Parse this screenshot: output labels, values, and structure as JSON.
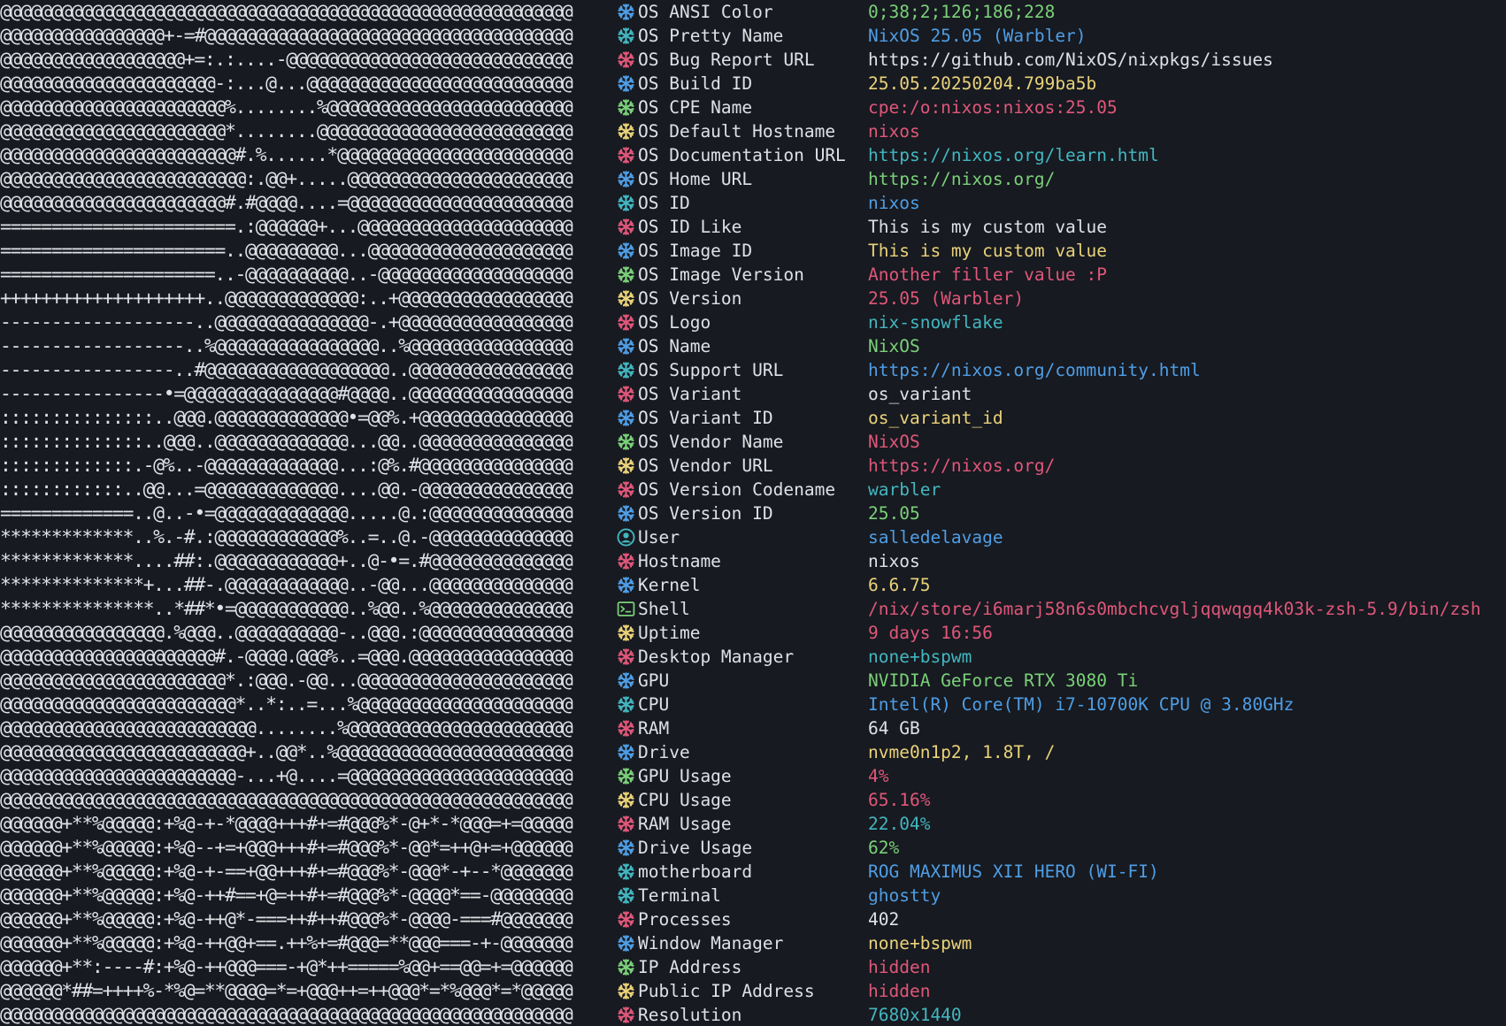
{
  "colors": {
    "background": "#171a20",
    "text": "#dfe1e5",
    "blue": "#4f9ee6",
    "cyan": "#43b6c0",
    "green": "#7bd07a",
    "yellow": "#ead27a",
    "red": "#e0577a"
  },
  "ascii_art": [
    "@@@@@@@@@@@@@@@@@@@@@@@@@@@@@@@@@@@@@@@@@@@@@@@@@@@@@@@@",
    "@@@@@@@@@@@@@@@@+-=#@@@@@@@@@@@@@@@@@@@@@@@@@@@@@@@@@@@@",
    "@@@@@@@@@@@@@@@@@@+=:.:....-@@@@@@@@@@@@@@@@@@@@@@@@@@@@",
    "@@@@@@@@@@@@@@@@@@@@@-:...@...@@@@@@@@@@@@@@@@@@@@@@@@@@",
    "@@@@@@@@@@@@@@@@@@@@@@%........%@@@@@@@@@@@@@@@@@@@@@@@@",
    "@@@@@@@@@@@@@@@@@@@@@@*........@@@@@@@@@@@@@@@@@@@@@@@@@",
    "@@@@@@@@@@@@@@@@@@@@@@@#.%......*@@@@@@@@@@@@@@@@@@@@@@@",
    "@@@@@@@@@@@@@@@@@@@@@@@@:.@@+.....@@@@@@@@@@@@@@@@@@@@@@",
    "@@@@@@@@@@@@@@@@@@@@@@#.#@@@@....=@@@@@@@@@@@@@@@@@@@@@@",
    "=======================.:@@@@@@+...@@@@@@@@@@@@@@@@@@@@@",
    "======================..@@@@@@@@@...@@@@@@@@@@@@@@@@@@@@",
    "=====================..-@@@@@@@@@@..-@@@@@@@@@@@@@@@@@@@",
    "++++++++++++++++++++..@@@@@@@@@@@@@:..+@@@@@@@@@@@@@@@@@",
    "-------------------..@@@@@@@@@@@@@@@-.+@@@@@@@@@@@@@@@@@",
    "------------------..%@@@@@@@@@@@@@@@@..%@@@@@@@@@@@@@@@@",
    "-----------------..#@@@@@@@@@@@@@@@@@@..@@@@@@@@@@@@@@@@",
    "----------------•=@@@@@@@@@@@@@@@#@@@@..@@@@@@@@@@@@@@@@",
    ":::::::::::::::..@@@.@@@@@@@@@@@@@•=@@%.+@@@@@@@@@@@@@@@",
    "::::::::::::::..@@@..@@@@@@@@@@@@@...@@..@@@@@@@@@@@@@@@",
    ":::::::::::::.-@%..-@@@@@@@@@@@@@...:@%.#@@@@@@@@@@@@@@@",
    "::::::::::::..@@...=@@@@@@@@@@@@@....@@.-@@@@@@@@@@@@@@@",
    "=============..@..-•=@@@@@@@@@@@@@.....@.:@@@@@@@@@@@@@@",
    "*************..%.-#.:@@@@@@@@@@@@%..=..@.-@@@@@@@@@@@@@@",
    "*************....##:.@@@@@@@@@@@@+..@-•=.#@@@@@@@@@@@@@@",
    "**************+...##-.@@@@@@@@@@@@..-@@...@@@@@@@@@@@@@@",
    "***************..*##*•=@@@@@@@@@@@..%@@..%@@@@@@@@@@@@@@",
    "@@@@@@@@@@@@@@@@.%@@@..@@@@@@@@@@-..@@@.:@@@@@@@@@@@@@@@",
    "@@@@@@@@@@@@@@@@@@@@@#.-@@@@.@@@%..=@@@.@@@@@@@@@@@@@@@@",
    "@@@@@@@@@@@@@@@@@@@@@@*.:@@@.-@@...@@@@@@@@@@@@@@@@@@@@@",
    "@@@@@@@@@@@@@@@@@@@@@@@*..*:..=...%@@@@@@@@@@@@@@@@@@@@@",
    "@@@@@@@@@@@@@@@@@@@@@@@@@........%@@@@@@@@@@@@@@@@@@@@@@",
    "@@@@@@@@@@@@@@@@@@@@@@@@+..@@*..%@@@@@@@@@@@@@@@@@@@@@@@",
    "@@@@@@@@@@@@@@@@@@@@@@@-...+@....=@@@@@@@@@@@@@@@@@@@@@@",
    "@@@@@@@@@@@@@@@@@@@@@@@@@@@@@@@@@@@@@@@@@@@@@@@@@@@@@@@@",
    "@@@@@@+**%@@@@@:+%@-+-*@@@@+++#+=#@@@%*-@+*-*@@@=+=@@@@@",
    "@@@@@@+**%@@@@@:+%@--+=+@@@+++#+=#@@@%*-@@*=++@+=+@@@@@@",
    "@@@@@@+**%@@@@@:+%@-+-==+@@+++#+=#@@@%*-@@@*-+--*@@@@@@@",
    "@@@@@@+**%@@@@@:+%@-++#==+@=++#+=#@@@%*-@@@@*==-@@@@@@@@",
    "@@@@@@+**%@@@@@:+%@-++@*-===++#++#@@@%*-@@@@-===#@@@@@@@",
    "@@@@@@+**%@@@@@:+%@-++@@+==.++%+=#@@@=**@@@===-+-@@@@@@@",
    "@@@@@@+**:----#:+%@-++@@@===-+@*++=====%@@+==@@=+=@@@@@@",
    "@@@@@@*##=++++%-*%@=**@@@@=*=+@@@++=++@@@*=*%@@@*=*@@@@@",
    "@@@@@@@@@@@@@@@@@@@@@@@@@@@@@@@@@@@@@@@@@@@@@@@@@@@@@@@@"
  ],
  "info": [
    {
      "icon": "nix-snowflake-icon",
      "icon_color": "blue",
      "key": "OS ANSI Color",
      "value": "0;38;2;126;186;228",
      "value_color": "green"
    },
    {
      "icon": "nix-snowflake-icon",
      "icon_color": "cyan",
      "key": "OS Pretty Name",
      "value": "NixOS 25.05 (Warbler)",
      "value_color": "blue"
    },
    {
      "icon": "nix-snowflake-icon",
      "icon_color": "red",
      "key": "OS Bug Report URL",
      "value": "https://github.com/NixOS/nixpkgs/issues",
      "value_color": "text"
    },
    {
      "icon": "nix-snowflake-icon",
      "icon_color": "blue",
      "key": "OS Build ID",
      "value": "25.05.20250204.799ba5b",
      "value_color": "yellow"
    },
    {
      "icon": "nix-snowflake-icon",
      "icon_color": "green",
      "key": "OS CPE Name",
      "value": "cpe:/o:nixos:nixos:25.05",
      "value_color": "red"
    },
    {
      "icon": "nix-snowflake-icon",
      "icon_color": "yellow",
      "key": "OS Default Hostname",
      "value": "nixos",
      "value_color": "red"
    },
    {
      "icon": "nix-snowflake-icon",
      "icon_color": "red",
      "key": "OS Documentation URL",
      "value": "https://nixos.org/learn.html",
      "value_color": "cyan"
    },
    {
      "icon": "nix-snowflake-icon",
      "icon_color": "blue",
      "key": "OS Home URL",
      "value": "https://nixos.org/",
      "value_color": "green"
    },
    {
      "icon": "nix-snowflake-icon",
      "icon_color": "cyan",
      "key": "OS ID",
      "value": "nixos",
      "value_color": "blue"
    },
    {
      "icon": "nix-snowflake-icon",
      "icon_color": "red",
      "key": "OS ID Like",
      "value": "This is my custom value",
      "value_color": "text"
    },
    {
      "icon": "nix-snowflake-icon",
      "icon_color": "blue",
      "key": "OS Image ID",
      "value": "This is my custom value",
      "value_color": "yellow"
    },
    {
      "icon": "nix-snowflake-icon",
      "icon_color": "green",
      "key": "OS Image Version",
      "value": "Another filler value :P",
      "value_color": "red"
    },
    {
      "icon": "nix-snowflake-icon",
      "icon_color": "yellow",
      "key": "OS Version",
      "value": "25.05 (Warbler)",
      "value_color": "red"
    },
    {
      "icon": "nix-snowflake-icon",
      "icon_color": "red",
      "key": "OS Logo",
      "value": "nix-snowflake",
      "value_color": "cyan"
    },
    {
      "icon": "nix-snowflake-icon",
      "icon_color": "blue",
      "key": "OS Name",
      "value": "NixOS",
      "value_color": "green"
    },
    {
      "icon": "nix-snowflake-icon",
      "icon_color": "cyan",
      "key": "OS Support URL",
      "value": "https://nixos.org/community.html",
      "value_color": "blue"
    },
    {
      "icon": "nix-snowflake-icon",
      "icon_color": "red",
      "key": "OS Variant",
      "value": "os_variant",
      "value_color": "text"
    },
    {
      "icon": "nix-snowflake-icon",
      "icon_color": "blue",
      "key": "OS Variant ID",
      "value": "os_variant_id",
      "value_color": "yellow"
    },
    {
      "icon": "nix-snowflake-icon",
      "icon_color": "green",
      "key": "OS Vendor Name",
      "value": "NixOS",
      "value_color": "red"
    },
    {
      "icon": "nix-snowflake-icon",
      "icon_color": "yellow",
      "key": "OS Vendor URL",
      "value": "https://nixos.org/",
      "value_color": "red"
    },
    {
      "icon": "nix-snowflake-icon",
      "icon_color": "red",
      "key": "OS Version Codename",
      "value": "warbler",
      "value_color": "cyan"
    },
    {
      "icon": "nix-snowflake-icon",
      "icon_color": "blue",
      "key": "OS Version ID",
      "value": "25.05",
      "value_color": "green"
    },
    {
      "icon": "user-icon",
      "icon_color": "cyan",
      "key": "User",
      "value": "salledelavage",
      "value_color": "blue"
    },
    {
      "icon": "nix-snowflake-icon",
      "icon_color": "red",
      "key": "Hostname",
      "value": "nixos",
      "value_color": "text"
    },
    {
      "icon": "nix-snowflake-icon",
      "icon_color": "blue",
      "key": "Kernel",
      "value": "6.6.75",
      "value_color": "yellow"
    },
    {
      "icon": "terminal-icon",
      "icon_color": "green",
      "key": "Shell",
      "value": "/nix/store/i6marj58n6s0mbchcvgljqqwqgq4k03k-zsh-5.9/bin/zsh",
      "value_color": "red"
    },
    {
      "icon": "nix-snowflake-icon",
      "icon_color": "yellow",
      "key": "Uptime",
      "value": "9 days 16:56",
      "value_color": "red"
    },
    {
      "icon": "nix-snowflake-icon",
      "icon_color": "red",
      "key": "Desktop Manager",
      "value": "none+bspwm",
      "value_color": "cyan"
    },
    {
      "icon": "nix-snowflake-icon",
      "icon_color": "blue",
      "key": "GPU",
      "value": "NVIDIA GeForce RTX 3080 Ti",
      "value_color": "green"
    },
    {
      "icon": "nix-snowflake-icon",
      "icon_color": "cyan",
      "key": "CPU",
      "value": "Intel(R) Core(TM) i7-10700K CPU @ 3.80GHz",
      "value_color": "blue"
    },
    {
      "icon": "nix-snowflake-icon",
      "icon_color": "red",
      "key": "RAM",
      "value": "64 GB",
      "value_color": "text"
    },
    {
      "icon": "nix-snowflake-icon",
      "icon_color": "blue",
      "key": "Drive",
      "value": "nvme0n1p2, 1.8T, /",
      "value_color": "yellow"
    },
    {
      "icon": "nix-snowflake-icon",
      "icon_color": "green",
      "key": "GPU Usage",
      "value": "4%",
      "value_color": "red"
    },
    {
      "icon": "nix-snowflake-icon",
      "icon_color": "yellow",
      "key": "CPU Usage",
      "value": "65.16%",
      "value_color": "red"
    },
    {
      "icon": "nix-snowflake-icon",
      "icon_color": "red",
      "key": "RAM Usage",
      "value": "22.04%",
      "value_color": "cyan"
    },
    {
      "icon": "nix-snowflake-icon",
      "icon_color": "blue",
      "key": "Drive Usage",
      "value": "62%",
      "value_color": "green"
    },
    {
      "icon": "nix-snowflake-icon",
      "icon_color": "cyan",
      "key": "motherboard",
      "value": "ROG MAXIMUS XII HERO (WI-FI)",
      "value_color": "blue"
    },
    {
      "icon": "nix-snowflake-icon",
      "icon_color": "cyan",
      "key": "Terminal",
      "value": "ghostty",
      "value_color": "blue"
    },
    {
      "icon": "nix-snowflake-icon",
      "icon_color": "red",
      "key": "Processes",
      "value": "402",
      "value_color": "text"
    },
    {
      "icon": "nix-snowflake-icon",
      "icon_color": "blue",
      "key": "Window Manager",
      "value": "none+bspwm",
      "value_color": "yellow"
    },
    {
      "icon": "nix-snowflake-icon",
      "icon_color": "green",
      "key": "IP Address",
      "value": "hidden",
      "value_color": "red"
    },
    {
      "icon": "nix-snowflake-icon",
      "icon_color": "yellow",
      "key": "Public IP Address",
      "value": "hidden",
      "value_color": "red"
    },
    {
      "icon": "nix-snowflake-icon",
      "icon_color": "red",
      "key": "Resolution",
      "value": "7680x1440",
      "value_color": "cyan"
    }
  ]
}
